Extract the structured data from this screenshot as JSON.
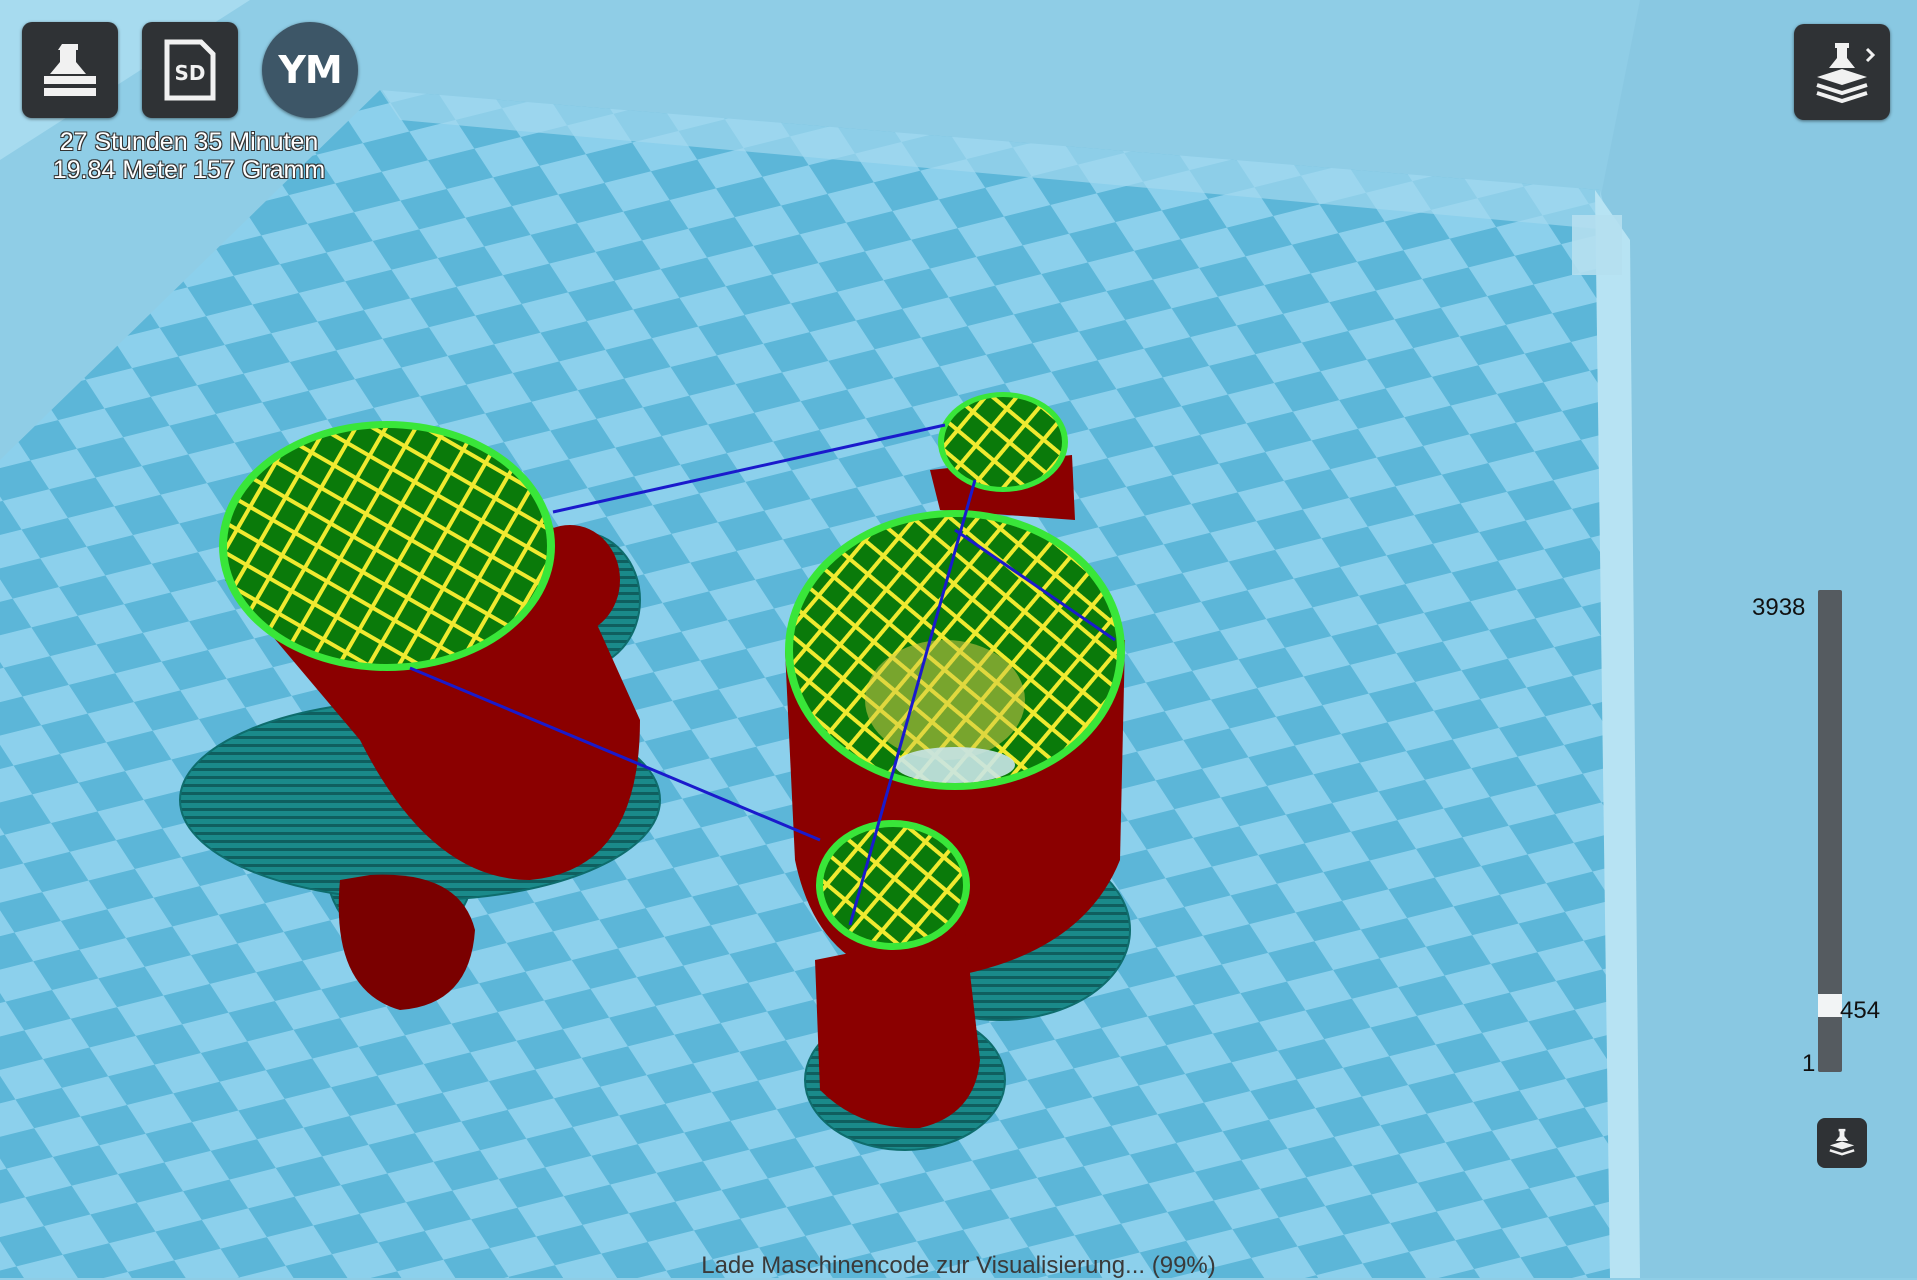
{
  "toolbar": {
    "print_icon": "printer-icon",
    "sd_label": "SD",
    "account_initials": "YM",
    "layers_icon": "layer-view-icon"
  },
  "estimate": {
    "time": "27 Stunden 35 Minuten",
    "material": "19.84 Meter 157 Gramm"
  },
  "layer_slider": {
    "max_label": "3938",
    "current_label": "454",
    "min_label": "1",
    "current": 454,
    "min": 1,
    "max": 3938
  },
  "status": {
    "message": "Lade Maschinencode zur Visualisierung... (99%)"
  },
  "colors": {
    "build_plate_light": "#8cd0ec",
    "build_plate_dark": "#5cb6d8",
    "wall": "#8b0000",
    "infill_bg": "#0a7a0a",
    "infill_lines": "#f0ea30",
    "outline": "#39e639",
    "travel": "#1a1acc",
    "skirt": "#1a8a8a"
  }
}
